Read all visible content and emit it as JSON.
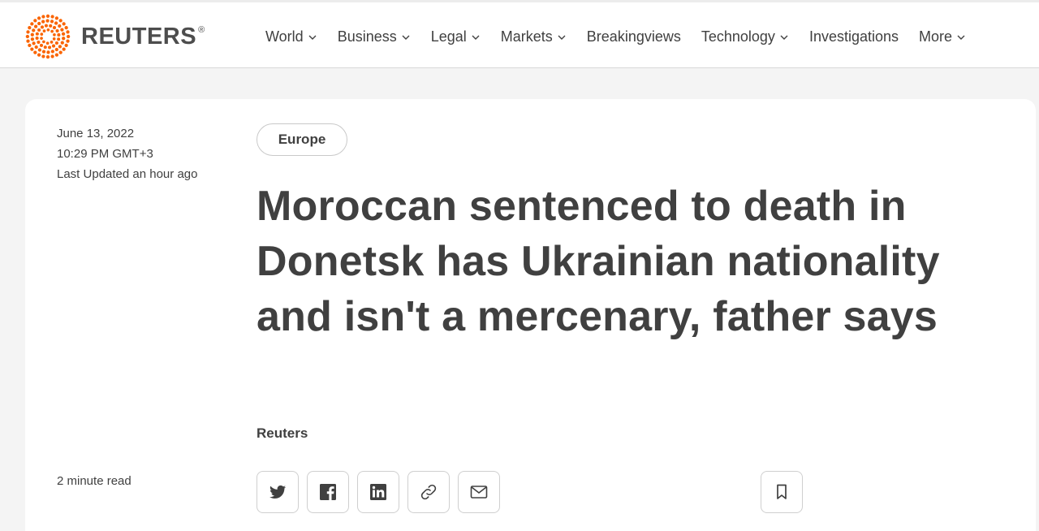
{
  "brand": {
    "name": "REUTERS",
    "registered": "®",
    "accent_color": "#fa6400"
  },
  "nav": {
    "items": [
      {
        "label": "World",
        "dropdown": true
      },
      {
        "label": "Business",
        "dropdown": true
      },
      {
        "label": "Legal",
        "dropdown": true
      },
      {
        "label": "Markets",
        "dropdown": true
      },
      {
        "label": "Breakingviews",
        "dropdown": false
      },
      {
        "label": "Technology",
        "dropdown": true
      },
      {
        "label": "Investigations",
        "dropdown": false
      },
      {
        "label": "More",
        "dropdown": true
      }
    ]
  },
  "article": {
    "date": "June 13, 2022",
    "time": "10:29 PM GMT+3",
    "updated": "Last Updated an hour ago",
    "category": "Europe",
    "headline": "Moroccan sentenced to death in Donetsk has Ukrainian nationality and isn't a mercenary, father says",
    "byline": "Reuters",
    "read_time": "2 minute read"
  },
  "share": {
    "buttons": [
      "twitter-icon",
      "facebook-icon",
      "linkedin-icon",
      "link-icon",
      "email-icon"
    ],
    "bookmark": "bookmark-icon"
  }
}
